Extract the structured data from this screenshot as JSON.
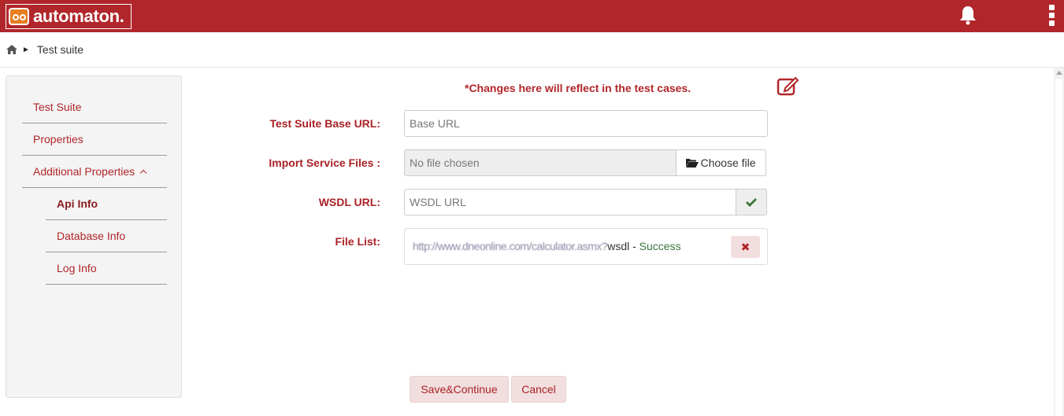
{
  "app": {
    "logo_text": "automaton.",
    "brand_color": "#b1262a"
  },
  "header": {
    "icons": [
      "bell-icon",
      "kebab-menu-icon"
    ]
  },
  "breadcrumb": {
    "current": "Test suite"
  },
  "sidebar": {
    "items": [
      {
        "label": "Test Suite"
      },
      {
        "label": "Properties"
      },
      {
        "label": "Additional Properties"
      }
    ],
    "sub_items": [
      {
        "label": "Api Info",
        "active": true
      },
      {
        "label": "Database Info"
      },
      {
        "label": "Log Info"
      }
    ]
  },
  "form": {
    "notice": "*Changes here will reflect in the test cases.",
    "base_url": {
      "label": "Test Suite Base URL:",
      "placeholder": "Base URL",
      "value": ""
    },
    "import": {
      "label": "Import Service Files :",
      "status": "No file chosen",
      "button": "Choose file"
    },
    "wsdl": {
      "label": "WSDL URL:",
      "placeholder": "WSDL URL",
      "value": ""
    },
    "file_list": {
      "label": "File List:",
      "url_obscured": "http://www.dneonline.com/calculator.asmx?",
      "url_suffix": "wsdl",
      "separator": " - ",
      "status": "Success"
    }
  },
  "actions": {
    "save": "Save&Continue",
    "cancel": "Cancel"
  }
}
